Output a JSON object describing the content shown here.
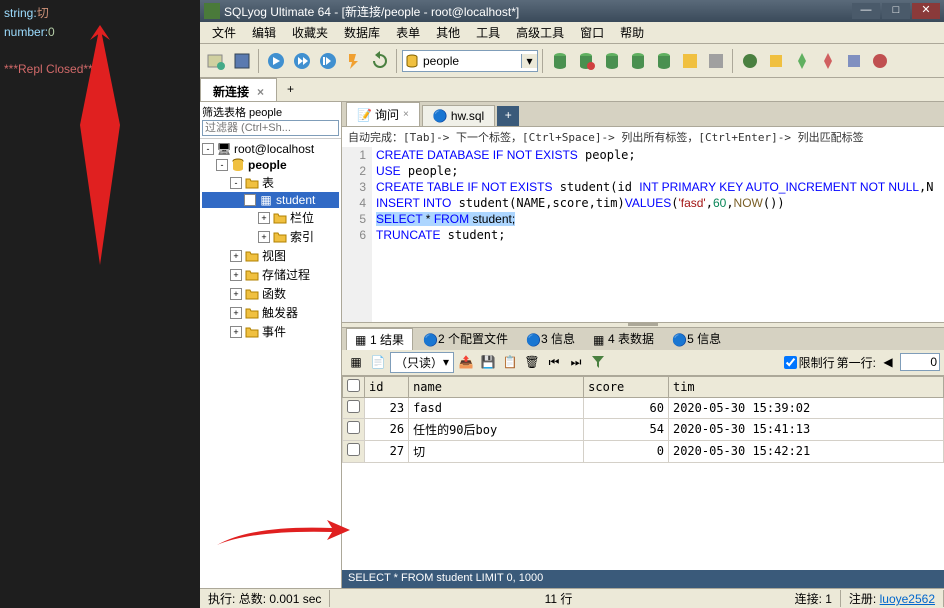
{
  "left_code": {
    "line1_label": "string:",
    "line1_value": "切",
    "line2_label": "number:",
    "line2_value": "0",
    "closed": "***Repl Closed***"
  },
  "window": {
    "title": "SQLyog Ultimate 64 - [新连接/people - root@localhost*]",
    "min": "—",
    "max": "□",
    "close": "✕"
  },
  "menu": [
    "文件",
    "编辑",
    "收藏夹",
    "数据库",
    "表单",
    "其他",
    "工具",
    "高级工具",
    "窗口",
    "帮助"
  ],
  "db_selector": "people",
  "conn_tab": "新连接",
  "sidebar": {
    "filter_label": "筛选表格 people",
    "filter_placeholder": "过滤器 (Ctrl+Sh...",
    "root": "root@localhost",
    "db": "people",
    "tables": "表",
    "student": "student",
    "columns": "栏位",
    "indexes": "索引",
    "views": "视图",
    "procs": "存储过程",
    "funcs": "函数",
    "triggers": "触发器",
    "events": "事件"
  },
  "tabs": {
    "query": "询问",
    "hw": "hw.sql"
  },
  "hint": "自动完成：[Tab]-> 下一个标签，[Ctrl+Space]-> 列出所有标签，[Ctrl+Enter]-> 列出匹配标签",
  "sql_lines": [
    "1",
    "2",
    "3",
    "4",
    "5",
    "6"
  ],
  "result_tabs": {
    "result": "1 结果",
    "profiles": "2 个配置文件",
    "info3": "3 信息",
    "tabledata": "4 表数据",
    "info5": "5 信息"
  },
  "result_toolbar": {
    "readonly": "（只读）",
    "limit_label": "限制行",
    "first_row": "第一行:",
    "first_val": "0"
  },
  "grid": {
    "cols": [
      "id",
      "name",
      "score",
      "tim"
    ],
    "rows": [
      {
        "id": "23",
        "name": "fasd",
        "score": "60",
        "tim": "2020-05-30 15:39:02"
      },
      {
        "id": "26",
        "name": "任性的90后boy",
        "score": "54",
        "tim": "2020-05-30 15:41:13"
      },
      {
        "id": "27",
        "name": "切",
        "score": "0",
        "tim": "2020-05-30 15:42:21"
      }
    ]
  },
  "status_query": "SELECT * FROM student LIMIT 0, 1000",
  "status": {
    "exec": "执行:",
    "total": "总数: 0.001 sec",
    "rows": "11 行",
    "conn": "连接: 1",
    "reg_label": "注册:",
    "reg_user": "luoye2562"
  }
}
